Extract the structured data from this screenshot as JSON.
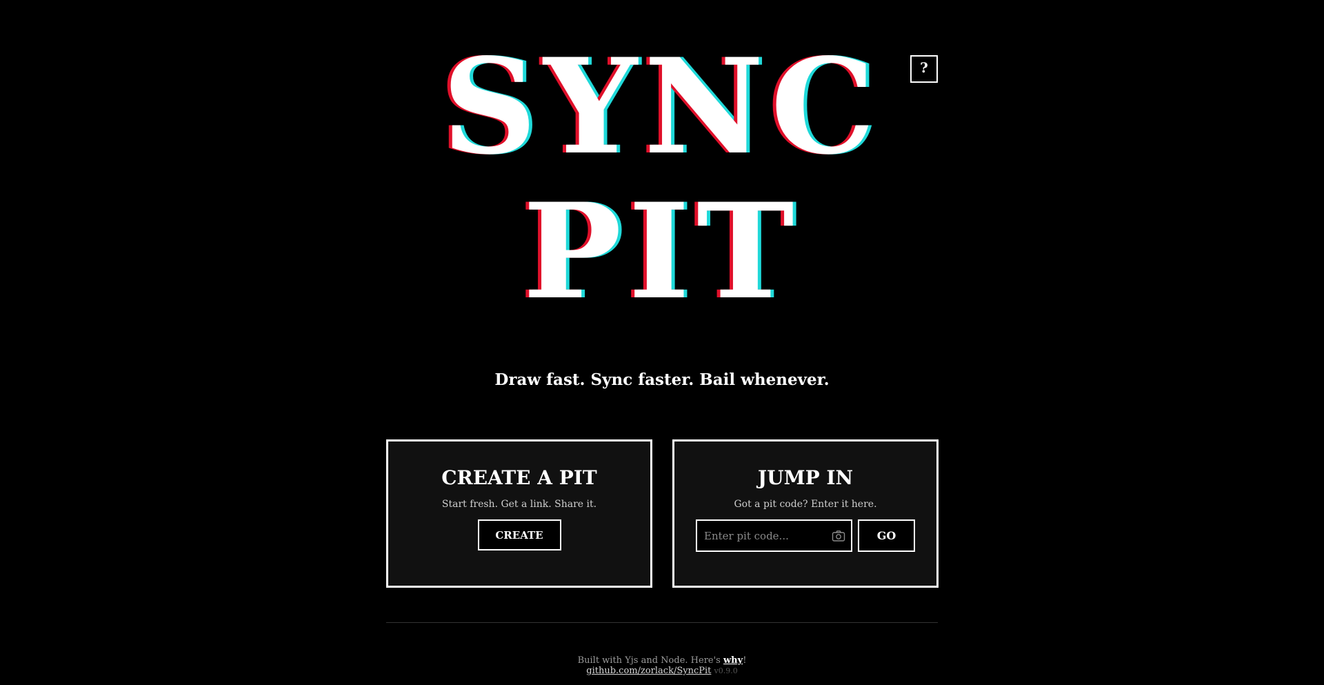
{
  "logo": {
    "line1": "SYNC",
    "line2": "PIT"
  },
  "help": {
    "label": "?"
  },
  "tagline": "Draw fast. Sync faster. Bail whenever.",
  "create_card": {
    "title": "CREATE A PIT",
    "description": "Start fresh. Get a link. Share it.",
    "button_label": "CREATE"
  },
  "join_card": {
    "title": "JUMP IN",
    "description": "Got a pit code? Enter it here.",
    "input_placeholder": "Enter pit code...",
    "input_value": "",
    "camera_icon": "camera-icon",
    "go_label": "GO"
  },
  "footer": {
    "built_prefix": "Built with Yjs and Node. Here's ",
    "why_link": "why",
    "built_suffix": "!",
    "repo_link": "github.com/zorlack/SyncPit",
    "version": "v0.9.0"
  },
  "colors": {
    "background": "#000000",
    "glitch_red": "#e0102a",
    "glitch_cyan": "#1fd9d9"
  }
}
